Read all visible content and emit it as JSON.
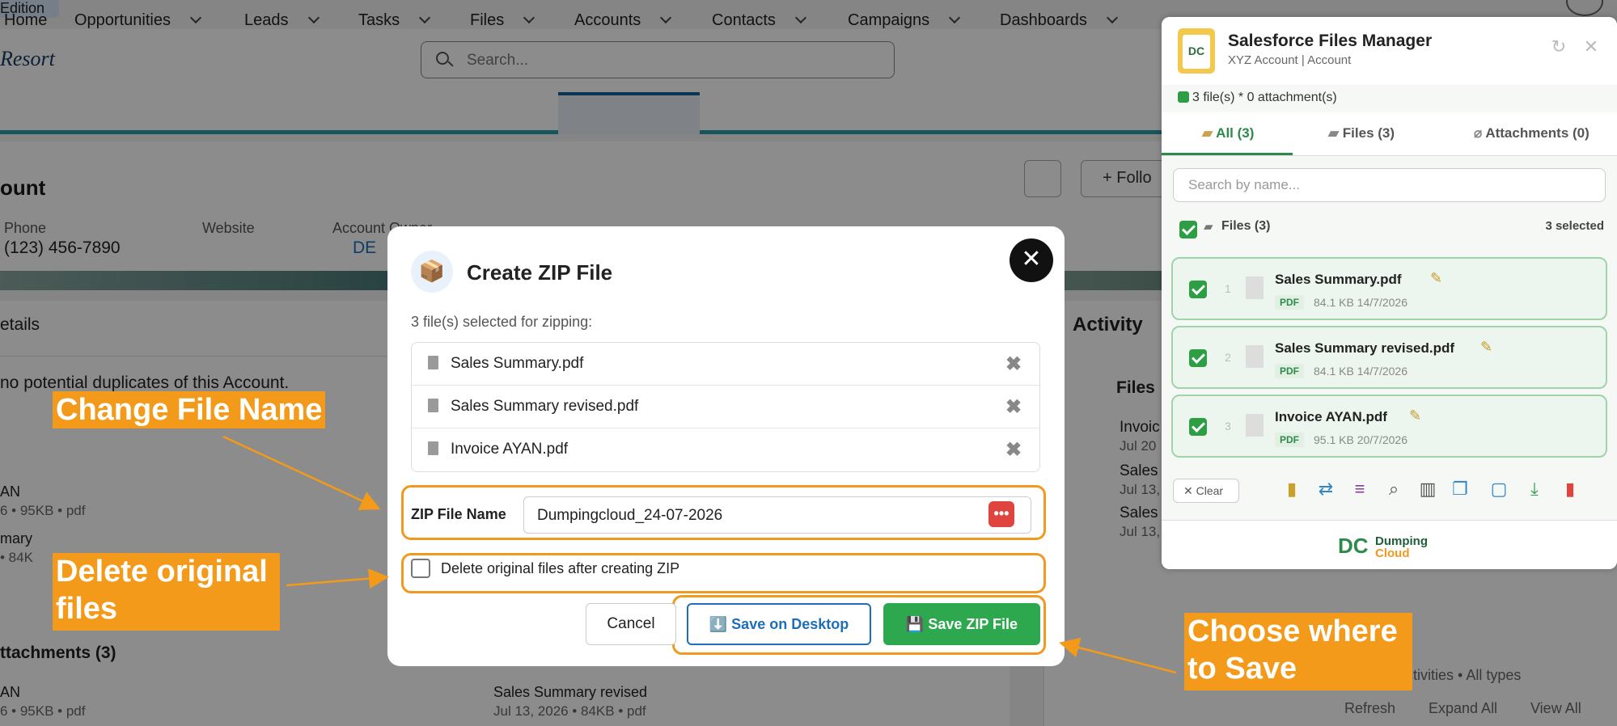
{
  "app": {
    "edition": "Edition",
    "logo": "Resort",
    "search_placeholder": "Search..."
  },
  "nav": {
    "items": [
      "Home",
      "Opportunities",
      "Leads",
      "Tasks",
      "Files",
      "Accounts",
      "Contacts",
      "Campaigns",
      "Dashboards"
    ]
  },
  "record": {
    "title": "ount",
    "follow_label": "+ Follo",
    "fields": [
      {
        "label": "Phone",
        "value": "(123) 456-7890"
      },
      {
        "label": "Website",
        "value": ""
      },
      {
        "label": "Account Owner",
        "value": "DE"
      }
    ]
  },
  "left": {
    "details_tab": "etails",
    "duplicates_text": "no potential duplicates of this Account.",
    "item1_name": "AN",
    "item1_meta": "6 • 95KB • pdf",
    "item2_name": "mary",
    "item2_meta": "• 84K",
    "attachments_title": "ttachments (3)",
    "item3_name": "AN",
    "item3_meta": "6 • 95KB • pdf",
    "item4_name": "Sales Summary revised",
    "item4_meta": "Jul 13, 2026 • 84KB • pdf"
  },
  "right": {
    "activity_title": "Activity",
    "files_title": "Files",
    "files": [
      {
        "name": "Invoic",
        "date": "Jul 20"
      },
      {
        "name": "Sales",
        "date": "Jul 13,"
      },
      {
        "name": "Sales",
        "date": "Jul 13,"
      }
    ],
    "filter_text": "ctivities • All types",
    "links": [
      "Refresh",
      "Expand All",
      "View All"
    ]
  },
  "files_manager": {
    "title": "Salesforce Files Manager",
    "subtitle": "XYZ Account | Account",
    "count_text": "3 file(s) * 0 attachment(s)",
    "tabs": [
      "All (3)",
      "Files (3)",
      "Attachments (0)"
    ],
    "search_placeholder": "Search by name...",
    "group_label": "Files (3)",
    "group_selected": "3 selected",
    "items": [
      {
        "num": "1",
        "name": "Sales Summary.pdf",
        "ext": "PDF",
        "meta": "84.1 KB 14/7/2026"
      },
      {
        "num": "2",
        "name": "Sales Summary revised.pdf",
        "ext": "PDF",
        "meta": "84.1 KB 14/7/2026"
      },
      {
        "num": "3",
        "name": "Invoice AYAN.pdf",
        "ext": "PDF",
        "meta": "95.1 KB 20/7/2026"
      }
    ],
    "clear_label": "✕ Clear",
    "brand_logo": "DC",
    "brand_line1": "Dumping",
    "brand_line2": "Cloud"
  },
  "modal": {
    "title": "Create ZIP File",
    "caption": "3 file(s) selected for zipping:",
    "files": [
      "Sales Summary.pdf",
      "Sales Summary revised.pdf",
      "Invoice AYAN.pdf"
    ],
    "zip_label": "ZIP File Name",
    "zip_value": "Dumpingcloud_24-07-2026",
    "delete_label": "Delete original files after creating ZIP",
    "cancel_label": "Cancel",
    "desktop_label": "⬇️ Save on Desktop",
    "save_zip_label": "💾 Save ZIP File"
  },
  "annotations": {
    "change_name": "Change File Name",
    "delete_line1": "Delete original",
    "delete_line2": "files",
    "choose_line1": "Choose where",
    "choose_line2": "to Save"
  },
  "colors": {
    "accent_orange": "#f49a1a",
    "save_green": "#2ea84f",
    "desktop_blue": "#1c6fb8"
  }
}
